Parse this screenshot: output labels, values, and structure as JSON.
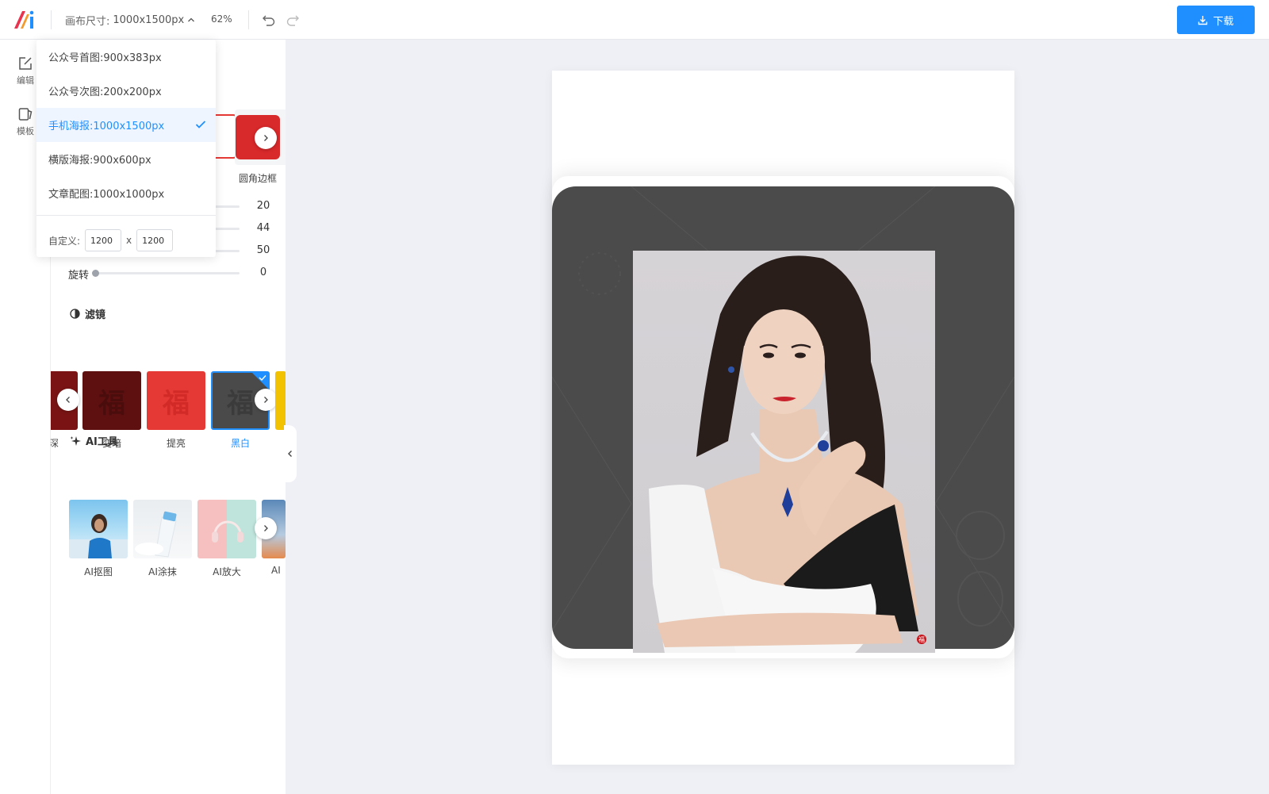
{
  "toolbar": {
    "canvas_size_label": "画布尺寸:",
    "canvas_size_value": "1000x1500px",
    "zoom": "62%",
    "download_label": "下载"
  },
  "rail": {
    "items": [
      {
        "label": "编辑",
        "icon": "edit-icon"
      },
      {
        "label": "模板",
        "icon": "template-icon"
      }
    ]
  },
  "size_menu": {
    "options": [
      {
        "label": "公众号首图:900x383px",
        "selected": false
      },
      {
        "label": "公众号次图:200x200px",
        "selected": false
      },
      {
        "label": "手机海报:1000x1500px",
        "selected": true
      },
      {
        "label": "横版海报:900x600px",
        "selected": false
      },
      {
        "label": "文章配图:1000x1000px",
        "selected": false
      }
    ],
    "custom_label": "自定义:",
    "custom_width": "1200",
    "custom_height": "1200",
    "times": "x"
  },
  "frames": {
    "visible_label": "圆角边框"
  },
  "sliders": [
    {
      "name": "",
      "value": "20",
      "fraction": 0.2
    },
    {
      "name": "",
      "value": "44",
      "fraction": 0.44
    },
    {
      "name": "",
      "value": "50",
      "fraction": 0.5
    },
    {
      "name": "旋转",
      "value": "0",
      "fraction": 0.0
    }
  ],
  "filters": {
    "title": "滤镜",
    "items": [
      {
        "label": "深",
        "color": "#7a1414",
        "selected": false
      },
      {
        "label": "变暗",
        "color": "#5e1010",
        "selected": false
      },
      {
        "label": "提亮",
        "color": "#e53935",
        "selected": false
      },
      {
        "label": "黑白",
        "color": "#4a4a4a",
        "selected": true
      }
    ]
  },
  "ai_tools": {
    "title": "AI工具",
    "items": [
      {
        "label": "AI抠图"
      },
      {
        "label": "AI涂抹"
      },
      {
        "label": "AI放大"
      },
      {
        "label": "AI"
      }
    ]
  },
  "canvas": {
    "seal_text": "福"
  },
  "colors": {
    "accent": "#1f8fff",
    "frame": "#4b4b4b"
  }
}
